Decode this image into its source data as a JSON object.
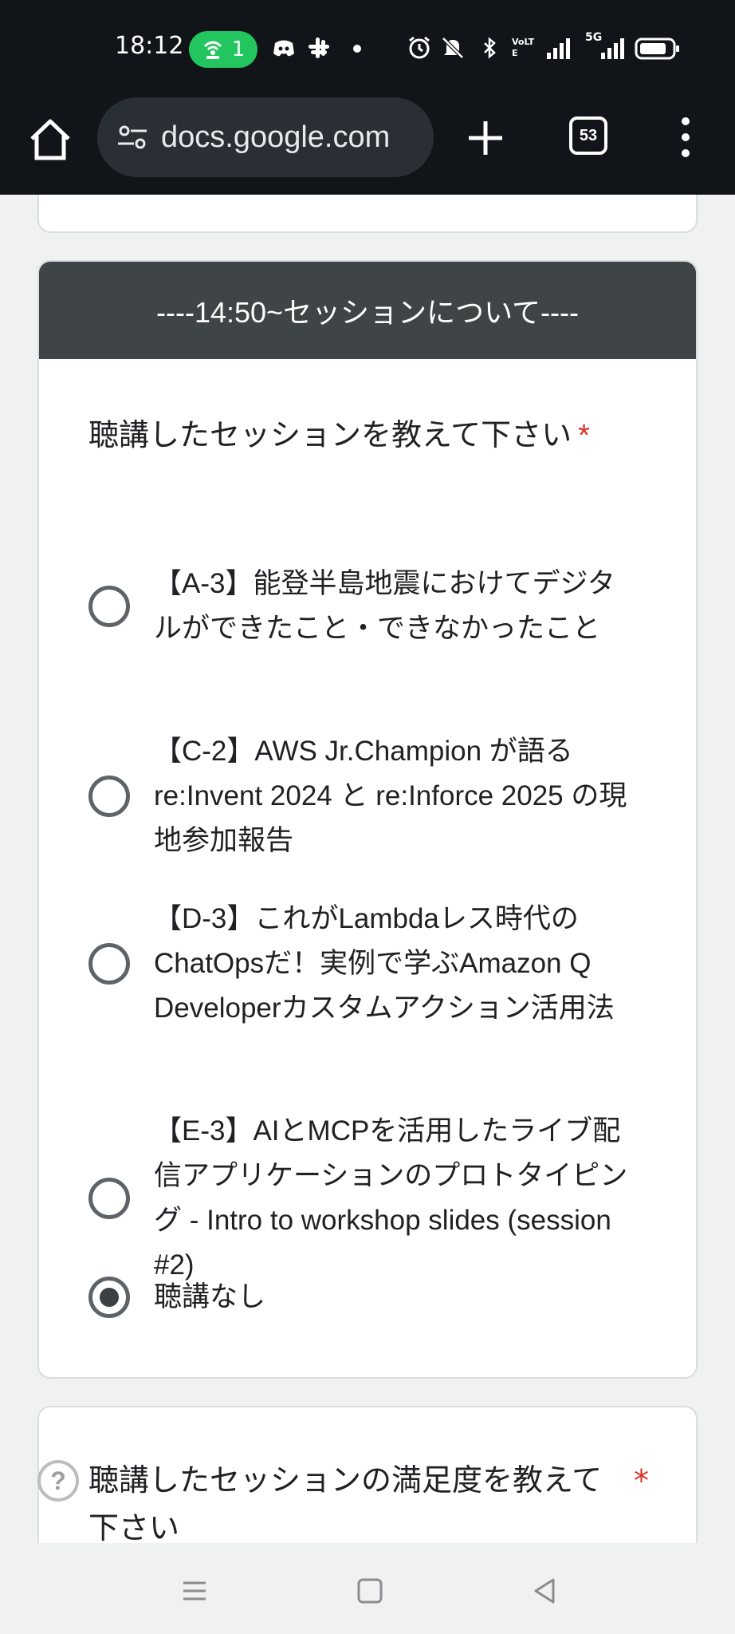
{
  "status_bar": {
    "time": "18:12",
    "hotspot_count": "1",
    "network": "5G",
    "volte": "VoLTE",
    "icons": [
      "hotspot-icon",
      "discord-icon",
      "slack-icon",
      "dot-icon",
      "alarm-icon",
      "mute-icon",
      "bluetooth-icon",
      "signal-icon",
      "battery-icon"
    ]
  },
  "browser": {
    "url": "docs.google.com",
    "tab_count": "53"
  },
  "section": {
    "header": "----14:50~セッションについて----",
    "question": {
      "title": "聴講したセッションを教えて下さい",
      "required_mark": "*",
      "options": [
        {
          "label": "【A-3】能登半島地震におけてデジタルができたこと・できなかったこと",
          "checked": false
        },
        {
          "label": "【C-2】AWS Jr.Champion が語る re:Invent 2024 と re:Inforce 2025 の現地参加報告",
          "checked": false
        },
        {
          "label": "【D-3】これがLambdaレス時代のChatOpsだ！実例で学ぶAmazon Q Developerカスタムアクション活用法",
          "checked": false
        },
        {
          "label": "【E-3】AIとMCPを活用したライブ配信アプリケーションのプロトタイピング - Intro to workshop slides (session #2)",
          "checked": false
        },
        {
          "label": "聴講なし",
          "checked": true
        }
      ]
    }
  },
  "next_question": {
    "title": "聴講したセッションの満足度を教えて下さい",
    "required_mark": "*",
    "help_glyph": "?"
  },
  "colors": {
    "chrome_bg": "#111418",
    "section_header_bg": "#3f4447",
    "required": "#d93025",
    "hotspot": "#22c55e"
  }
}
